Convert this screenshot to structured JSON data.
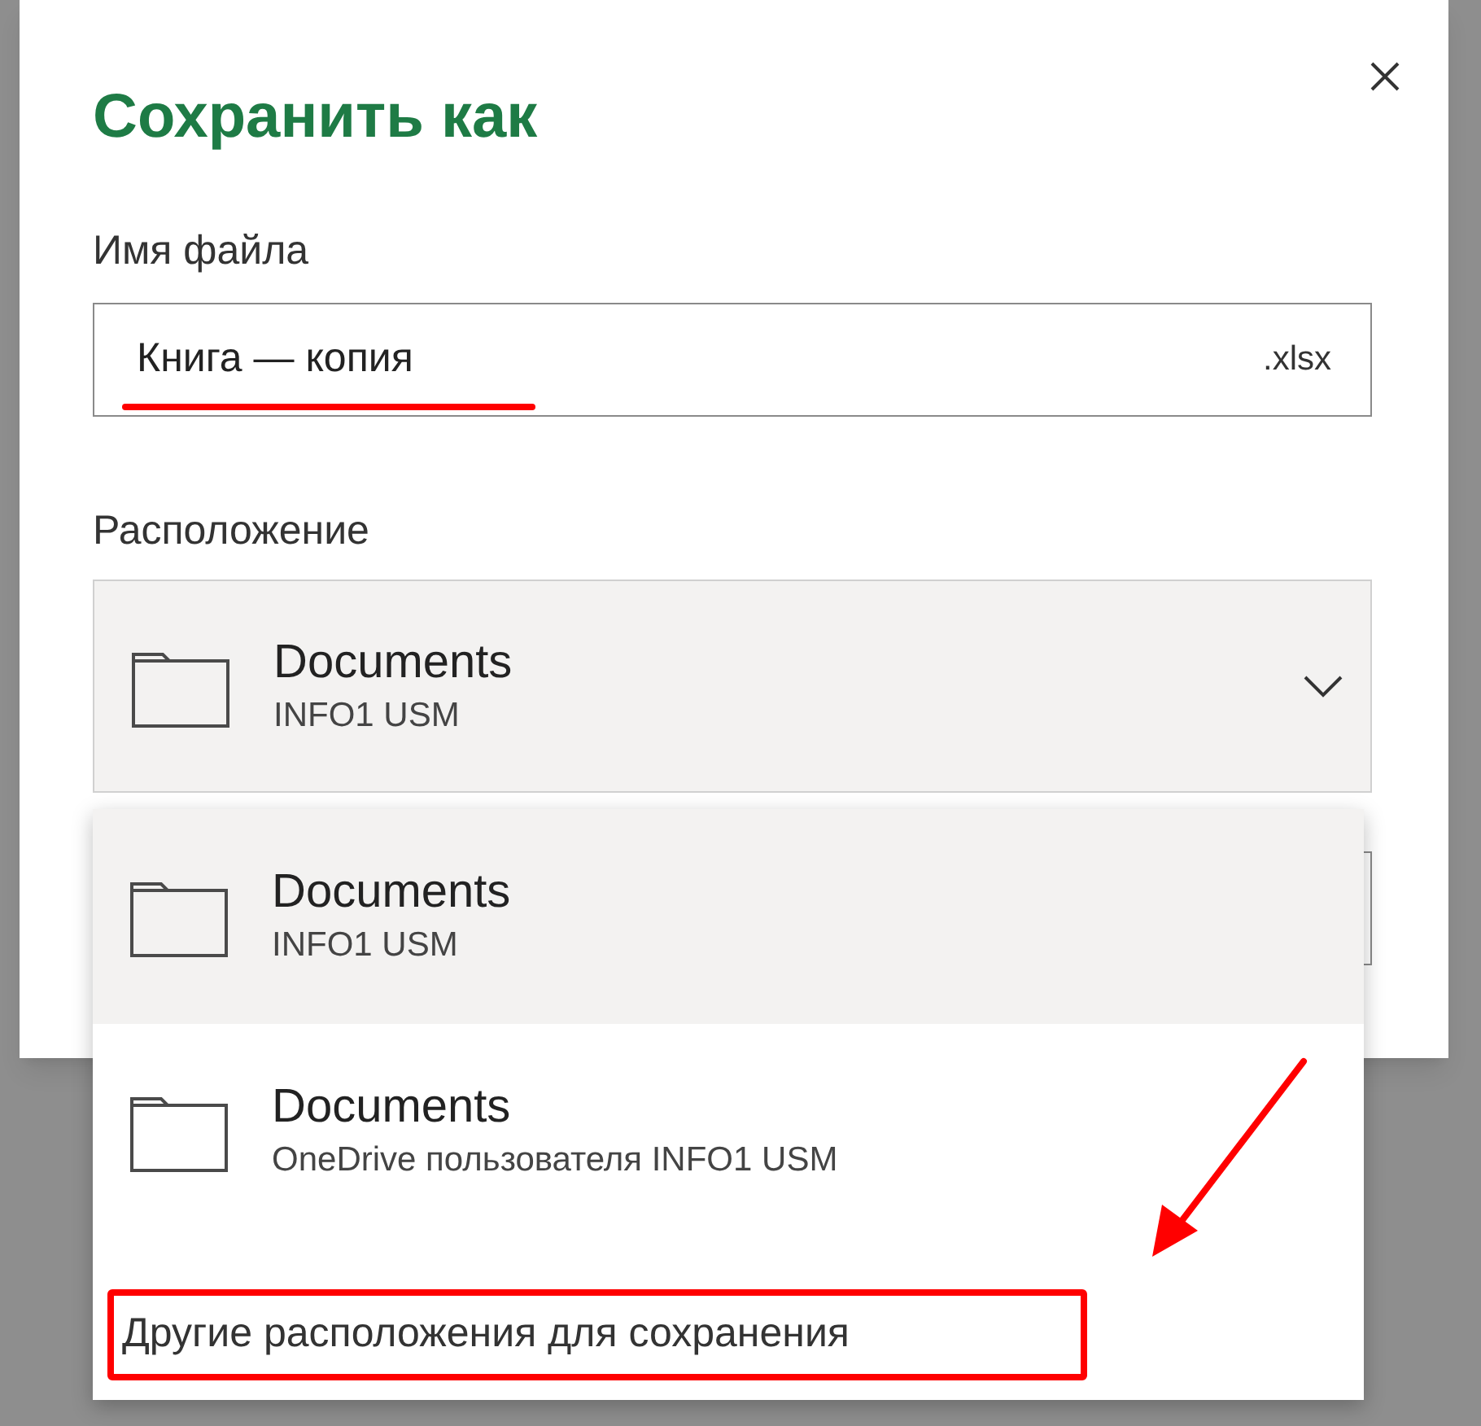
{
  "dialog": {
    "title": "Сохранить как",
    "file_name": {
      "label": "Имя файла",
      "value": "Книга — копия",
      "extension": ".xlsx"
    },
    "location": {
      "label": "Расположение",
      "name": "Documents",
      "account": "INFO1 USM",
      "expanded": true
    },
    "location_options": [
      {
        "name": "Documents",
        "account": "INFO1 USM",
        "selected": true
      },
      {
        "name": "Documents",
        "account": "OneDrive пользователя INFO1 USM",
        "selected": false
      }
    ],
    "more_locations": "Другие расположения для сохранения"
  }
}
